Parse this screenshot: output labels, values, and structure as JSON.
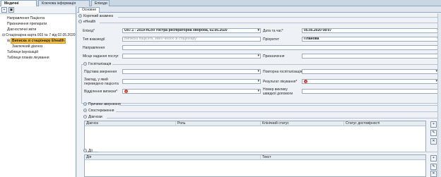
{
  "top_tabs": [
    "Медичні документи",
    "Ключова інформація пацієнта",
    "Епізоди"
  ],
  "left_toolbar": {
    "add_icon": "+",
    "save_icon": "▣"
  },
  "tree": {
    "items": [
      {
        "label": "Направлення Пацієнта",
        "indent": 1
      },
      {
        "label": "Призначення препарати",
        "indent": 1
      },
      {
        "label": "Діагностичні звіти",
        "indent": 1
      },
      {
        "label": "Стаціонарна карта 003 № 7 від 02.05.2020",
        "indent": 0,
        "toggle": "⊟"
      },
      {
        "label": "Виписка зі стаціонару Ehealth",
        "indent": 1,
        "toggle": "⊞",
        "selected": true
      },
      {
        "label": "Заключний діагноз",
        "indent": 2
      },
      {
        "label": "Таблиця Імунізацій",
        "indent": 0
      },
      {
        "label": "Таблиця планів лікування",
        "indent": 0
      }
    ]
  },
  "sub_tab": "Основне",
  "sections": {
    "short_anamnesis": "Короткий анамнез",
    "ehealth": "eHealth",
    "hospitalization": "Госпіталізація",
    "reasons": "Причини звернення",
    "observations": "Спостереження",
    "diagnoses": "Діагнози",
    "actions": "Дії"
  },
  "form": {
    "episode_label": "Епізод*",
    "episode_value": "U07.1 - 2019-nCoV гостра респіраторна хвороба, 02.05.2020",
    "date_label": "Дата та час*",
    "date_value": "05.05.2020 08:07",
    "interaction_type_label": "Тип взаємодії",
    "interaction_type_placeholder": "Виписка пацієнта, зміні чи/або зі стаціонару",
    "priority_label": "Пріоритет",
    "priority_value": "Планова",
    "referral_label": "Направлення",
    "place_label": "Місце надання послуг",
    "purpose_label": "Призначення"
  },
  "hosp": {
    "reason_label": "Підстава звернення",
    "repeat_label": "Повторна госпіталізація",
    "facility_label": "Заклад, у який переведено пацієнта",
    "result_label": "Результат лікування*",
    "dept_label": "Відділення виписки*",
    "ambulance_label": "Номер виклику швидкої допомоги"
  },
  "diag_columns": [
    "Діагноз",
    "Роль",
    "Клінічний статус",
    "Статус достовірності"
  ],
  "action_columns": [
    "Дія",
    "Текст"
  ],
  "side_buttons": {
    "add": "+",
    "edit": "✎",
    "delete": "✕"
  }
}
